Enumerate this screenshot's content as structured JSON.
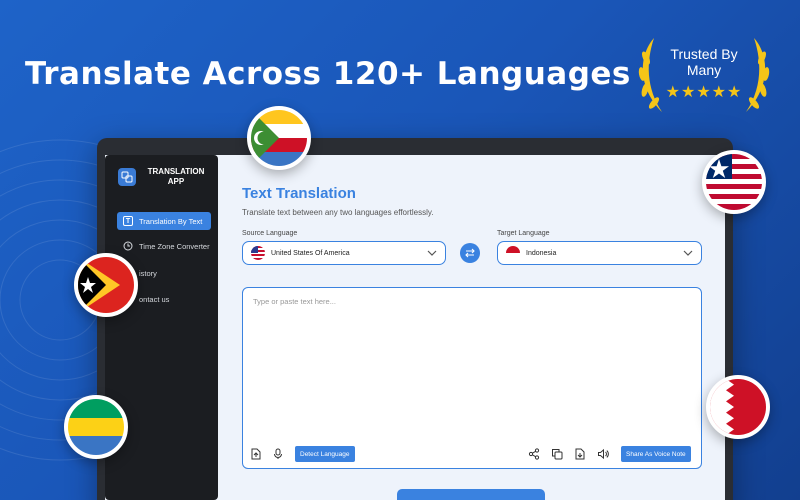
{
  "hero": {
    "headline": "Translate Across 120+ Languages"
  },
  "badge": {
    "line1": "Trusted By",
    "line2": "Many",
    "stars": "★★★★★"
  },
  "app": {
    "brand": {
      "line1": "TRANSLATION",
      "line2": "APP"
    },
    "nav": [
      {
        "label": "Translation By Text",
        "icon": "text-icon",
        "active": true
      },
      {
        "label": "Time Zone Converter",
        "icon": "clock-icon",
        "active": false
      },
      {
        "label": "istory",
        "icon": "history-icon",
        "active": false
      },
      {
        "label": "ontact us",
        "icon": "contact-icon",
        "active": false
      }
    ],
    "main": {
      "title": "Text Translation",
      "subtitle": "Translate text between any two languages effortlessly.",
      "source": {
        "label": "Source Language",
        "value": "United States Of America"
      },
      "target": {
        "label": "Target Language",
        "value": "Indonesia"
      },
      "input": {
        "placeholder": "Type or paste text here..."
      },
      "detect_label": "Detect Language",
      "share_voice_label": "Share As Voice Note"
    }
  },
  "colors": {
    "accent": "#3a82e0",
    "background": "#1a56b8",
    "gold": "#f5c518"
  },
  "flags": [
    "Comoros",
    "Liberia",
    "Timor-Leste",
    "Gabon",
    "Bahrain"
  ]
}
